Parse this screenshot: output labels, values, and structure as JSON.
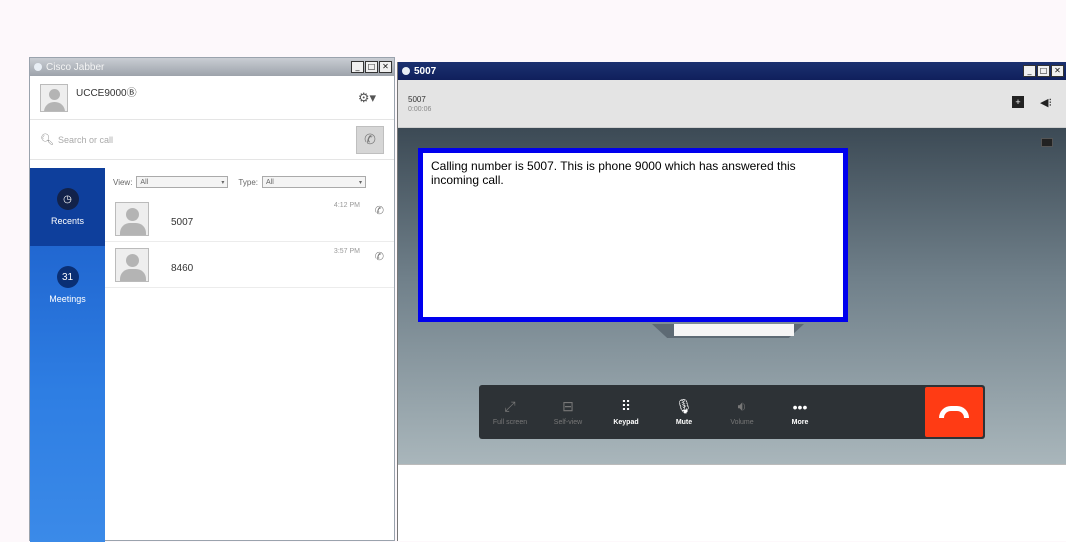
{
  "jabber": {
    "title": "Cisco Jabber",
    "username": "UCCE9000Ⓑ",
    "search_placeholder": "Search or call",
    "sidebar": [
      {
        "label": "Recents",
        "icon": "clock-icon"
      },
      {
        "label": "Meetings",
        "icon": "calendar-icon",
        "day": "31"
      }
    ],
    "filters": {
      "view_label": "View:",
      "view_value": "All",
      "type_label": "Type:",
      "type_value": "All"
    },
    "recents": [
      {
        "name": "5007",
        "time": "4:12 PM",
        "icon": "incoming-call-icon"
      },
      {
        "name": "8460",
        "time": "3:57 PM",
        "icon": "incoming-call-icon"
      }
    ]
  },
  "call": {
    "title": "5007",
    "number": "5007",
    "duration": "0:00:06",
    "annotation": "Calling number is 5007. This is phone 9000 which has answered this incoming call.",
    "controls": [
      {
        "label": "Full screen",
        "icon": "fullscreen-icon",
        "active": false
      },
      {
        "label": "Self-view",
        "icon": "self-view-icon",
        "active": false
      },
      {
        "label": "Keypad",
        "icon": "keypad-icon",
        "active": true
      },
      {
        "label": "Mute",
        "icon": "mute-icon",
        "active": true
      },
      {
        "label": "Volume",
        "icon": "volume-icon",
        "active": false
      },
      {
        "label": "More",
        "icon": "more-icon",
        "active": true
      }
    ],
    "end_call_color": "#ff3b14"
  }
}
